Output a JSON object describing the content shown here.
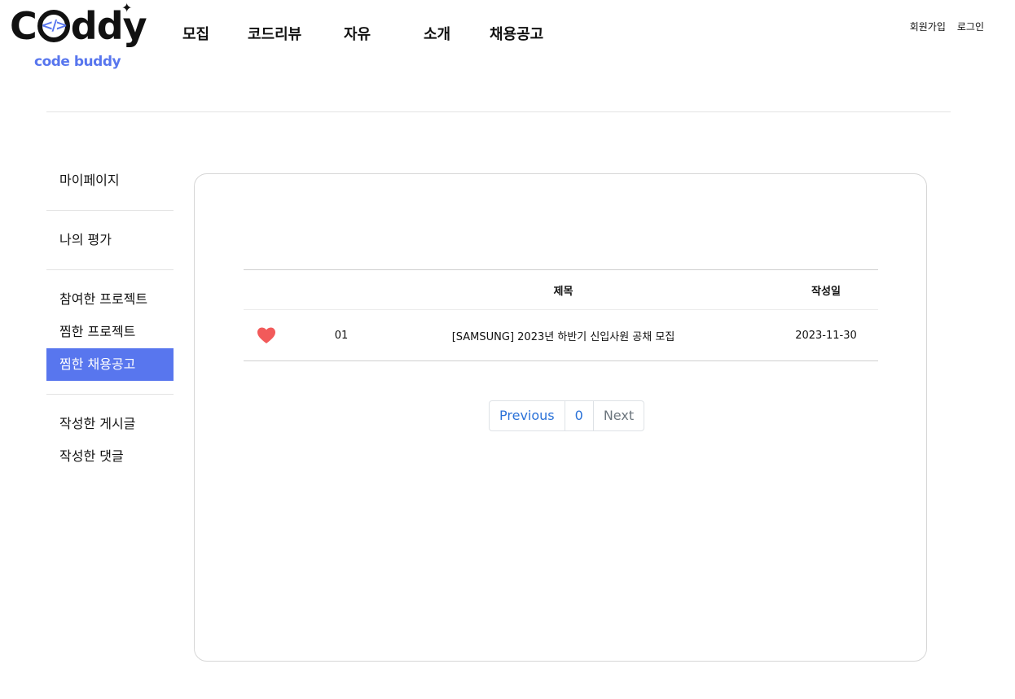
{
  "logo": {
    "main_prefix": "C",
    "main_code": "</>",
    "main_suffix": "ddy",
    "sub": "code buddy"
  },
  "nav": {
    "items": [
      "모집",
      "코드리뷰",
      "자유",
      "소개",
      "채용공고"
    ]
  },
  "auth": {
    "signup": "회원가입",
    "login": "로그인"
  },
  "sidebar": {
    "groups": [
      [
        "마이페이지"
      ],
      [
        "나의 평가"
      ],
      [
        "참여한 프로젝트",
        "찜한 프로젝트",
        "찜한 채용공고"
      ],
      [
        "작성한 게시글",
        "작성한 댓글"
      ]
    ],
    "active": "찜한 채용공고"
  },
  "table": {
    "headers": {
      "title": "제목",
      "date": "작성일"
    },
    "rows": [
      {
        "liked": true,
        "num": "01",
        "title": "[SAMSUNG] 2023년 하반기 신입사원 공채 모집",
        "date": "2023-11-30"
      }
    ]
  },
  "pagination": {
    "previous": "Previous",
    "current": "0",
    "next": "Next"
  },
  "colors": {
    "accent": "#5876ee",
    "heart": "#f25a5a",
    "link": "#2b72d8"
  }
}
